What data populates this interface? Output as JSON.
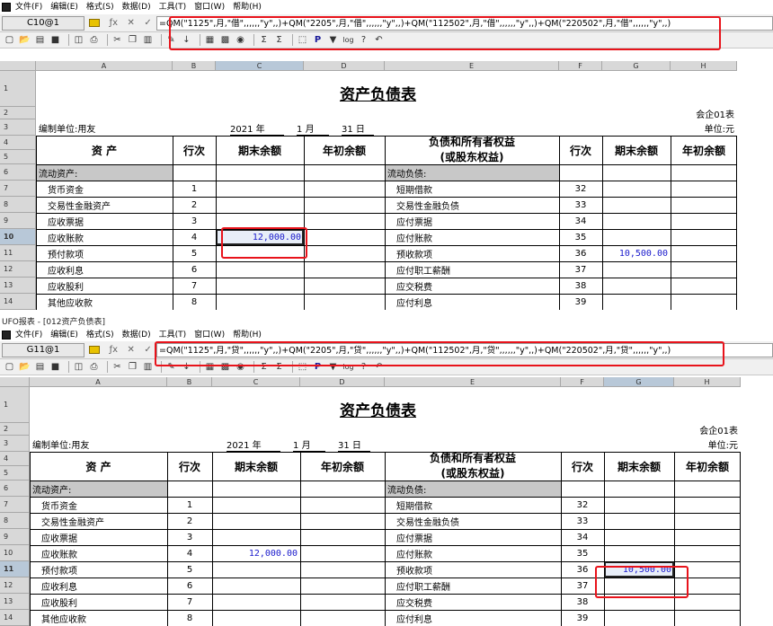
{
  "window_title_2": "UFO报表 - [012资产负债表]",
  "menu": [
    "文件(F)",
    "编辑(E)",
    "格式(S)",
    "数据(D)",
    "工具(T)",
    "窗口(W)",
    "帮助(H)"
  ],
  "panels": [
    {
      "cell_ref": "C10@1",
      "formula": "=QM(\"1125\",月,\"借\",,,,,,\"y\",,)+QM(\"2205\",月,\"借\",,,,,,\"y\",,)+QM(\"112502\",月,\"借\",,,,,,\"y\",,)+QM(\"220502\",月,\"借\",,,,,,\"y\",,)"
    },
    {
      "cell_ref": "G11@1",
      "formula": "=QM(\"1125\",月,\"贷\",,,,,,\"y\",,)+QM(\"2205\",月,\"贷\",,,,,,\"y\",,)+QM(\"112502\",月,\"贷\",,,,,,\"y\",,)+QM(\"220502\",月,\"贷\",,,,,,\"y\",,)"
    }
  ],
  "columns": [
    "A",
    "B",
    "C",
    "D",
    "E",
    "F",
    "G",
    "H"
  ],
  "sheet": {
    "title": "资产负债表",
    "form_code": "会企01表",
    "unit": "单位:元",
    "company": "编制单位:用友",
    "year": "2021",
    "year_label": "年",
    "month": "1",
    "month_label": "月",
    "day": "31",
    "day_label": "日",
    "headers": {
      "assets": "资    产",
      "line": "行次",
      "end_balance": "期末余额",
      "begin_balance": "年初余额",
      "liab_line1": "负债和所有者权益",
      "liab_line2": "(或股东权益)",
      "line2": "行次",
      "end_balance2": "期末余额",
      "begin_balance2": "年初余额"
    },
    "section_left": "流动资产:",
    "section_right": "流动负债:",
    "rows": [
      {
        "rn": "7",
        "asset": "货币资金",
        "line": "1",
        "end": "",
        "liab": "短期借款",
        "line2": "32",
        "end2": ""
      },
      {
        "rn": "8",
        "asset": "交易性金融资产",
        "line": "2",
        "end": "",
        "liab": "交易性金融负债",
        "line2": "33",
        "end2": ""
      },
      {
        "rn": "9",
        "asset": "应收票据",
        "line": "3",
        "end": "",
        "liab": "应付票据",
        "line2": "34",
        "end2": ""
      },
      {
        "rn": "10",
        "asset": "应收账款",
        "line": "4",
        "end": "12,000.00",
        "liab": "应付账款",
        "line2": "35",
        "end2": ""
      },
      {
        "rn": "11",
        "asset": "预付款项",
        "line": "5",
        "end": "",
        "liab": "预收款项",
        "line2": "36",
        "end2": "10,500.00"
      },
      {
        "rn": "12",
        "asset": "应收利息",
        "line": "6",
        "end": "",
        "liab": "应付职工薪酬",
        "line2": "37",
        "end2": ""
      },
      {
        "rn": "13",
        "asset": "应收股利",
        "line": "7",
        "end": "",
        "liab": "应交税费",
        "line2": "38",
        "end2": ""
      },
      {
        "rn": "14",
        "asset": "其他应收款",
        "line": "8",
        "end": "",
        "liab": "应付利息",
        "line2": "39",
        "end2": ""
      }
    ]
  },
  "toolbar_icons": [
    "new-icon",
    "open-icon",
    "close-doc-icon",
    "save-icon",
    "preview-icon",
    "print-icon",
    "cut-icon",
    "copy-icon",
    "paste-icon",
    "format-brush-icon",
    "sort-icon",
    "grid-icon",
    "chart-icon",
    "find-icon",
    "sum-icon",
    "sum-all-icon",
    "insert-icon",
    "p-icon",
    "filter-icon",
    "log-icon",
    "help-icon",
    "undo-icon"
  ]
}
